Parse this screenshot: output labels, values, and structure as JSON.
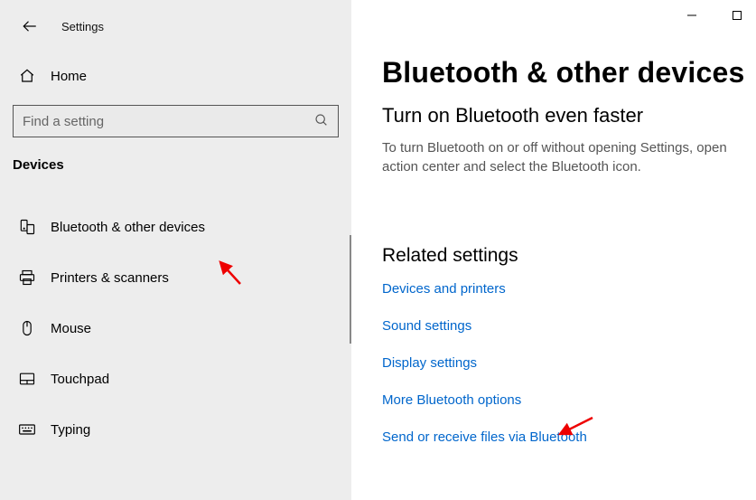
{
  "app_title": "Settings",
  "home_label": "Home",
  "search": {
    "placeholder": "Find a setting"
  },
  "section_header": "Devices",
  "nav": [
    {
      "key": "bluetooth",
      "label": "Bluetooth & other devices"
    },
    {
      "key": "printers",
      "label": "Printers & scanners"
    },
    {
      "key": "mouse",
      "label": "Mouse"
    },
    {
      "key": "touchpad",
      "label": "Touchpad"
    },
    {
      "key": "typing",
      "label": "Typing"
    }
  ],
  "page": {
    "title": "Bluetooth & other devices",
    "subtitle": "Turn on Bluetooth even faster",
    "body": "To turn Bluetooth on or off without opening Settings, open action center and select the Bluetooth icon.",
    "related_header": "Related settings",
    "links": [
      "Devices and printers",
      "Sound settings",
      "Display settings",
      "More Bluetooth options",
      "Send or receive files via Bluetooth"
    ]
  }
}
